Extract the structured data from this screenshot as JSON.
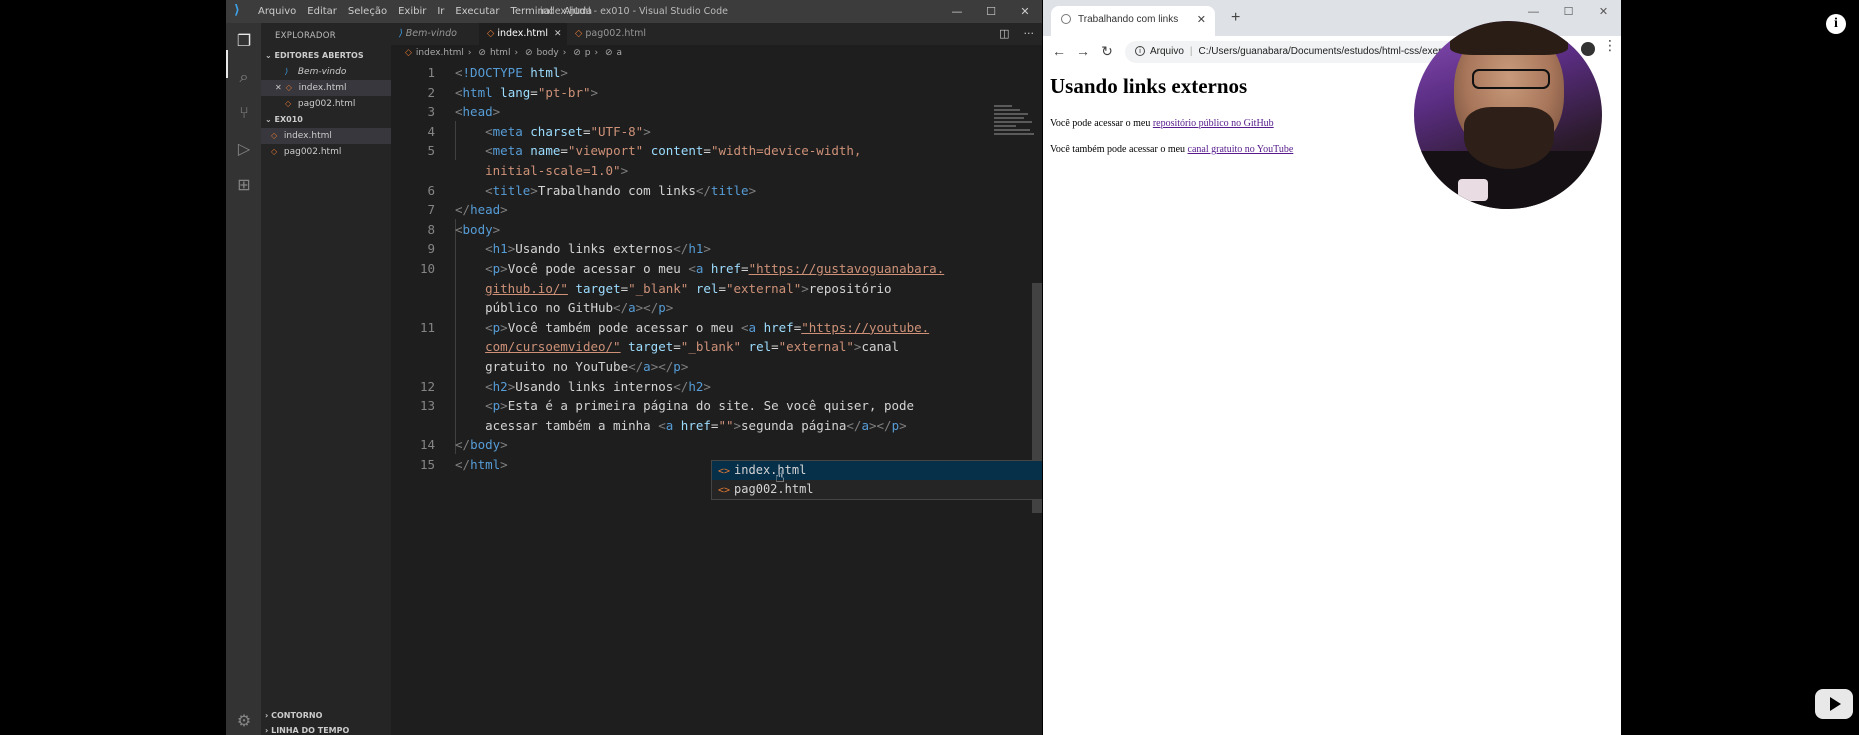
{
  "vscode": {
    "title": "index.html - ex010 - Visual Studio Code",
    "menu": [
      "Arquivo",
      "Editar",
      "Seleção",
      "Exibir",
      "Ir",
      "Executar",
      "Terminal",
      "Ajuda"
    ],
    "window_buttons": [
      "—",
      "☐",
      "✕"
    ],
    "sidebar": {
      "header": "EXPLORADOR",
      "open_editors_title": "EDITORES ABERTOS",
      "open_editors": [
        "Bem-vindo",
        "index.html",
        "pag002.html"
      ],
      "folder_title": "EX010",
      "folder_files": [
        "index.html",
        "pag002.html"
      ],
      "outline": "CONTORNO",
      "timeline": "LINHA DO TEMPO"
    },
    "tabs": [
      "Bem-vindo",
      "index.html",
      "pag002.html"
    ],
    "breadcrumb": [
      "index.html",
      "html",
      "body",
      "p",
      "a"
    ],
    "line_numbers": [
      "1",
      "2",
      "3",
      "4",
      "5",
      "6",
      "7",
      "8",
      "9",
      "10",
      "11",
      "12",
      "13",
      "14",
      "15"
    ],
    "code_text": {
      "doctype": "!DOCTYPE",
      "html_kw": "html",
      "lang_attr": "lang",
      "lang_val": "\"pt-br\"",
      "head": "head",
      "meta": "meta",
      "charset": "charset",
      "charset_val": "\"UTF-8\"",
      "name_attr": "name",
      "viewport_val": "\"viewport\"",
      "content_attr": "content",
      "content_val_1": "\"width=device-width,",
      "content_val_2": "initial-scale=1.0\"",
      "title_tag": "title",
      "title_text": "Trabalhando com links",
      "body": "body",
      "h1": "h1",
      "h1_text": "Usando links externos",
      "p": "p",
      "p1_text": "Você pode acessar o meu ",
      "a": "a",
      "href": "href",
      "href1_a": "\"https://gustavoguanabara.",
      "href1_b": "github.io/\"",
      "target": "target",
      "blank": "\"_blank\"",
      "rel": "rel",
      "external": "\"external\"",
      "link1_text_a": "repositório",
      "link1_text_b": "público no GitHub",
      "p2_text": "Você também pode acessar o meu ",
      "href2_a": "\"https://youtube.",
      "href2_b": "com/cursoemvideo/\"",
      "link2_text_a": "canal",
      "link2_text_b": "gratuito no YouTube",
      "h2": "h2",
      "h2_text": "Usando links internos",
      "p3_text_a": "Esta é a primeira página do site. Se você quiser, pode",
      "p3_text_b": "acessar também a minha ",
      "empty_attr": "\"\"",
      "p3_link_text": "segunda página"
    },
    "suggestions": [
      "index.html",
      "pag002.html"
    ]
  },
  "browser": {
    "tab_title": "Trabalhando com links",
    "new_tab": "+",
    "window_buttons": [
      "—",
      "☐",
      "✕"
    ],
    "address_label": "Arquivo",
    "address": "C:/Users/guanabara/Documents/estudos/html-css/exercicios/ex010/index.html",
    "page": {
      "h1": "Usando links externos",
      "p1_text": "Você pode acessar o meu ",
      "p1_link": "repositório público no GitHub",
      "p2_text": "Você também pode acessar o meu ",
      "p2_link": "canal gratuito no YouTube"
    }
  },
  "overlay": {
    "info_icon": "i"
  }
}
